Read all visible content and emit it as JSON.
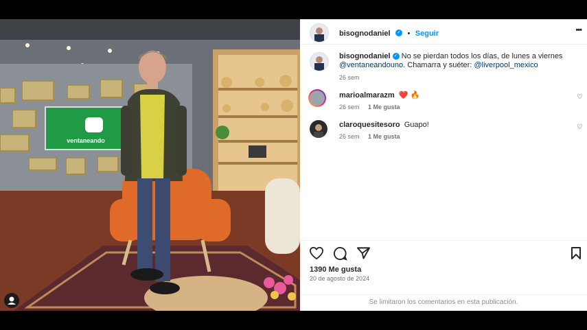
{
  "post": {
    "username": "bisognodaniel",
    "follow_label": "Seguir",
    "more_label": "•••",
    "caption_text": "No se pierdan todos los días, de lunes a viernes",
    "caption_mention": "@ventaneandouno",
    "caption_text2": ". Chamarra y suéter: ",
    "caption_mention2": "@liverpool_mexico",
    "caption_time": "26 sem",
    "studio_sign": "ventaneando"
  },
  "comments": [
    {
      "username": "marioalmarazm",
      "text": "❤️ 🔥",
      "time": "26 sem",
      "likes": "1 Me gusta"
    },
    {
      "username": "claroquesitesoro",
      "text": "Guapo!",
      "time": "26 sem",
      "likes": "1 Me gusta"
    }
  ],
  "footer": {
    "likes": "1390 Me gusta",
    "date": "20 de agosto de 2024",
    "comments_limited": "Se limitaron los comentarios en esta publicación."
  },
  "icons": [
    "like-icon",
    "comment-icon",
    "share-icon",
    "save-icon",
    "more-icon",
    "verified-icon",
    "user-icon"
  ],
  "colors": {
    "accent": "#0095f6",
    "link": "#00376b",
    "heart": "#ed4956"
  }
}
